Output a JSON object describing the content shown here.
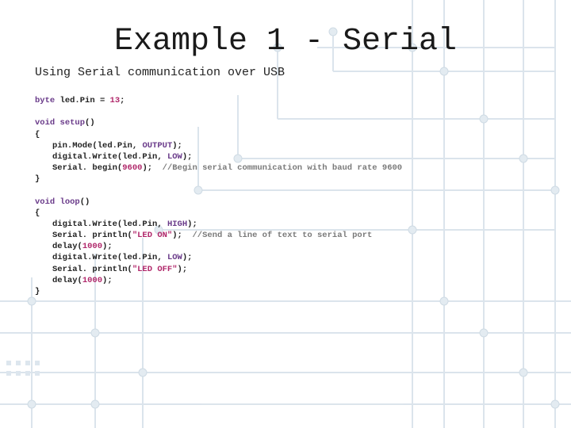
{
  "title": "Example 1 - Serial",
  "subtitle": "Using Serial communication over USB",
  "code": {
    "decl": {
      "kw": "byte",
      "id": "led.Pin = ",
      "num": "13",
      "semi": ";"
    },
    "setup_sig": {
      "kw": "void",
      "fn": "setup",
      "paren": "()"
    },
    "brace_open": "{",
    "brace_close": "}",
    "setup_l1": {
      "pre": "pin.Mode(",
      "arg1": "led.Pin, ",
      "arg2": "OUTPUT",
      "post": ");"
    },
    "setup_l2": {
      "pre": "digital.Write(",
      "arg1": "led.Pin, ",
      "arg2": "LOW",
      "post": ");"
    },
    "setup_l3": {
      "pre": "Serial. begin(",
      "num": "9600",
      "post": ");  ",
      "cmt": "//Begin serial communication with baud rate 9600"
    },
    "loop_sig": {
      "kw": "void",
      "fn": "loop",
      "paren": "()"
    },
    "loop_l1": {
      "pre": "digital.Write(",
      "arg1": "led.Pin, ",
      "arg2": "HIGH",
      "post": ");"
    },
    "loop_l2": {
      "pre": "Serial. println(",
      "str": "\"LED ON\"",
      "post": ");  ",
      "cmt": "//Send a line of text to serial port"
    },
    "loop_l3": {
      "pre": "delay(",
      "num": "1000",
      "post": ");"
    },
    "loop_l4": {
      "pre": "digital.Write(",
      "arg1": "led.Pin, ",
      "arg2": "LOW",
      "post": ");"
    },
    "loop_l5": {
      "pre": "Serial. println(",
      "str": "\"LED OFF\"",
      "post": ");"
    },
    "loop_l6": {
      "pre": "delay(",
      "num": "1000",
      "post": ");"
    }
  }
}
